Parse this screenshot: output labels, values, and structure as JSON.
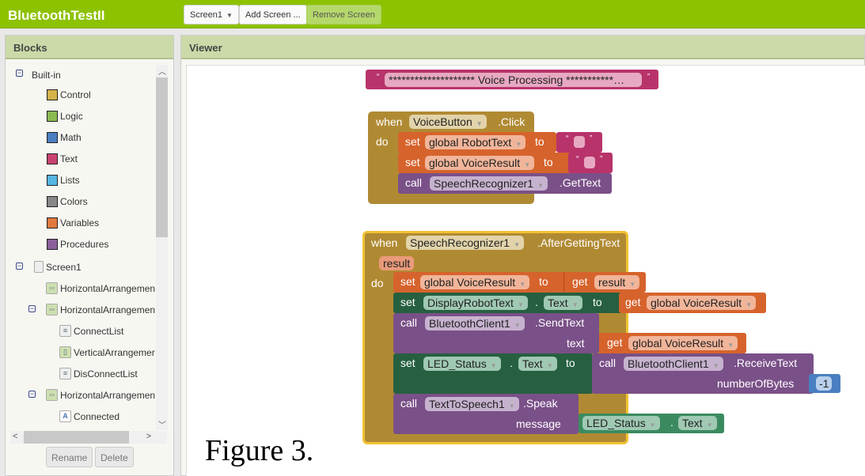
{
  "app": {
    "title": "BluetoothTestII"
  },
  "toolbar": {
    "screen_select": "Screen1",
    "add_screen": "Add Screen ...",
    "remove_screen": "Remove Screen"
  },
  "blocks_panel": {
    "title": "Blocks",
    "builtin": {
      "label": "Built-in",
      "items": [
        {
          "label": "Control",
          "color": "#d4b24c"
        },
        {
          "label": "Logic",
          "color": "#8bba50"
        },
        {
          "label": "Math",
          "color": "#4a7fc1"
        },
        {
          "label": "Text",
          "color": "#c8426f"
        },
        {
          "label": "Lists",
          "color": "#55b6e0"
        },
        {
          "label": "Colors",
          "color": "#888888"
        },
        {
          "label": "Variables",
          "color": "#e07a3c"
        },
        {
          "label": "Procedures",
          "color": "#8a5f9c"
        }
      ]
    },
    "components": [
      {
        "label": "Screen1"
      },
      {
        "label": "HorizontalArrangemen"
      },
      {
        "label": "HorizontalArrangemen"
      },
      {
        "label": "ConnectList"
      },
      {
        "label": "VerticalArrangemer"
      },
      {
        "label": "DisConnectList"
      },
      {
        "label": "HorizontalArrangemen"
      },
      {
        "label": "Connected"
      }
    ],
    "rename": "Rename",
    "delete": "Delete"
  },
  "viewer": {
    "title": "Viewer",
    "comment_block": {
      "open_quote": "“",
      "text": "******************** Voice Processing ***********…",
      "close_quote": "”"
    },
    "voice_click": {
      "when": "when",
      "component": "VoiceButton",
      "event": ".Click",
      "do": "do",
      "set1": {
        "kw": "set",
        "var": "global RobotText",
        "to": "to"
      },
      "set2": {
        "kw": "set",
        "var": "global VoiceResult",
        "to": "to"
      },
      "call": {
        "kw": "call",
        "component": "SpeechRecognizer1",
        "method": ".GetText"
      },
      "quote_open": "“",
      "quote_close": "”"
    },
    "after_text": {
      "when": "when",
      "component": "SpeechRecognizer1",
      "event": ".AfterGettingText",
      "param": "result",
      "do": "do",
      "s1": {
        "kw": "set",
        "var": "global VoiceResult",
        "to": "to",
        "get": "get",
        "val": "result"
      },
      "s2": {
        "kw": "set",
        "comp": "DisplayRobotText",
        "prop": "Text",
        "dot": ".",
        "to": "to",
        "get": "get",
        "val": "global VoiceResult"
      },
      "s3": {
        "kw": "call",
        "comp": "BluetoothClient1",
        "method": ".SendText",
        "arg": "text",
        "get": "get",
        "val": "global VoiceResult"
      },
      "s4": {
        "kw": "set",
        "comp": "LED_Status",
        "prop": "Text",
        "dot": ".",
        "to": "to",
        "call": "call",
        "comp2": "BluetoothClient1",
        "method": ".ReceiveText",
        "arg": "numberOfBytes",
        "num": "-1"
      },
      "s5": {
        "kw": "call",
        "comp": "TextToSpeech1",
        "method": ".Speak",
        "arg": "message",
        "comp2": "LED_Status",
        "dot": ".",
        "prop": "Text"
      }
    }
  },
  "caption": "Figure 3."
}
